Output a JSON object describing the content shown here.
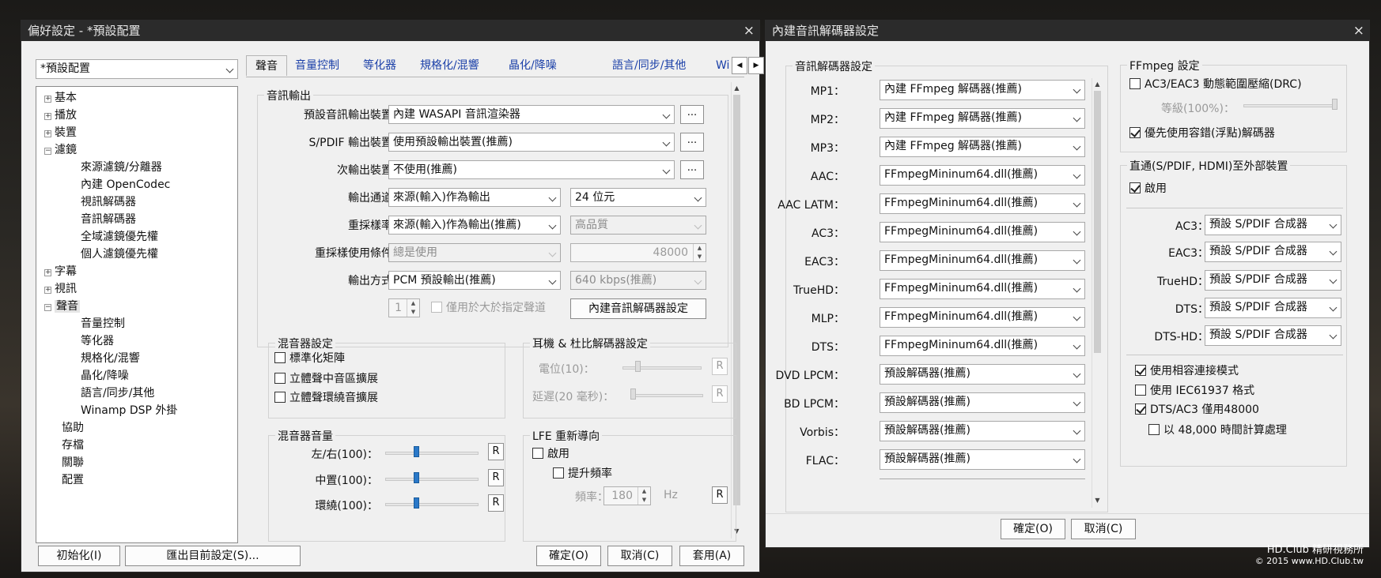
{
  "left_window": {
    "title": "偏好設定 - *預設配置",
    "close_label": "×",
    "profile_select": "*預設配置",
    "tree": [
      {
        "label": "基本",
        "toggle": "+"
      },
      {
        "label": "播放",
        "toggle": "+"
      },
      {
        "label": "裝置",
        "toggle": "+"
      },
      {
        "label": "濾鏡",
        "toggle": "−"
      },
      {
        "label": "來源濾鏡/分離器"
      },
      {
        "label": "內建 OpenCodec"
      },
      {
        "label": "視訊解碼器"
      },
      {
        "label": "音訊解碼器"
      },
      {
        "label": "全域濾鏡優先權"
      },
      {
        "label": "個人濾鏡優先權"
      },
      {
        "label": "字幕",
        "toggle": "+"
      },
      {
        "label": "視訊",
        "toggle": "+"
      },
      {
        "label": "聲音",
        "toggle": "−"
      },
      {
        "label": "音量控制"
      },
      {
        "label": "等化器"
      },
      {
        "label": "規格化/混響"
      },
      {
        "label": "晶化/降噪"
      },
      {
        "label": "語言/同步/其他"
      },
      {
        "label": "Winamp DSP 外掛"
      },
      {
        "label": "協助"
      },
      {
        "label": "存檔"
      },
      {
        "label": "關聯"
      },
      {
        "label": "配置"
      }
    ],
    "tabs": [
      "聲音",
      "音量控制",
      "等化器",
      "規格化/混響",
      "晶化/降噪",
      "語言/同步/其他",
      "Wi"
    ],
    "audio_output": {
      "group_title": "音訊輸出",
      "default_device_label": "預設音訊輸出裝置：",
      "default_device_value": "內建 WASAPI 音訊渲染器",
      "spdif_label": "S/PDIF 輸出裝置：",
      "spdif_value": "使用預設輸出裝置(推薦)",
      "secondary_label": "次輸出裝置：",
      "secondary_value": "不使用(推薦)",
      "channels_label": "輸出通道：",
      "channels_value": "來源(輸入)作為輸出",
      "bits_value": "24 位元",
      "resample_label": "重採樣率：",
      "resample_value": "來源(輸入)作為輸出(推薦)",
      "quality_value": "高品質",
      "resample_cond_label": "重採樣使用條件：",
      "resample_cond_value": "總是使用",
      "sample_rate_value": "48000",
      "output_method_label": "輸出方式：",
      "output_method_value": "PCM 預設輸出(推薦)",
      "bitrate_value": "640 kbps(推薦)",
      "channel_count_value": "1",
      "only_above_label": "僅用於大於指定聲道",
      "builtin_decoder_button": "內建音訊解碼器設定",
      "more_button": "..."
    },
    "mixer": {
      "title": "混音器設定",
      "normalize_matrix": "標準化矩陣",
      "stereo_center": "立體聲中音區擴展",
      "stereo_surround": "立體聲環繞音擴展"
    },
    "headphone": {
      "title": "耳機 & 杜比解碼器設定",
      "level_label": "電位(10)：",
      "delay_label": "延遲(20 毫秒)：",
      "reset_label": "R"
    },
    "mixer_volume": {
      "title": "混音器音量",
      "lr_label": "左/右(100)：",
      "center_label": "中置(100)：",
      "surround_label": "環繞(100)：",
      "reset_label": "R"
    },
    "lfe": {
      "title": "LFE 重新導向",
      "enable": "啟用",
      "boost": "提升頻率",
      "freq_label": "頻率：",
      "freq_value": "180",
      "hz_label": "Hz",
      "reset_label": "R"
    },
    "footer": {
      "init": "初始化(I)",
      "export": "匯出目前設定(S)...",
      "ok": "確定(O)",
      "cancel": "取消(C)",
      "apply": "套用(A)"
    }
  },
  "right_window": {
    "title": "內建音訊解碼器設定",
    "close_label": "×",
    "decoder_group_title": "音訊解碼器設定",
    "decoders": [
      {
        "label": "MP1：",
        "value": "內建 FFmpeg 解碼器(推薦)"
      },
      {
        "label": "MP2：",
        "value": "內建 FFmpeg 解碼器(推薦)"
      },
      {
        "label": "MP3：",
        "value": "內建 FFmpeg 解碼器(推薦)"
      },
      {
        "label": "AAC：",
        "value": "FFmpegMininum64.dll(推薦)"
      },
      {
        "label": "AAC LATM：",
        "value": "FFmpegMininum64.dll(推薦)"
      },
      {
        "label": "AC3：",
        "value": "FFmpegMininum64.dll(推薦)"
      },
      {
        "label": "EAC3：",
        "value": "FFmpegMininum64.dll(推薦)"
      },
      {
        "label": "TrueHD：",
        "value": "FFmpegMininum64.dll(推薦)"
      },
      {
        "label": "MLP：",
        "value": "FFmpegMininum64.dll(推薦)"
      },
      {
        "label": "DTS：",
        "value": "FFmpegMininum64.dll(推薦)"
      },
      {
        "label": "DVD LPCM：",
        "value": "預設解碼器(推薦)"
      },
      {
        "label": "BD LPCM：",
        "value": "預設解碼器(推薦)"
      },
      {
        "label": "Vorbis：",
        "value": "預設解碼器(推薦)"
      },
      {
        "label": "FLAC：",
        "value": "預設解碼器(推薦)"
      }
    ],
    "ffmpeg": {
      "title": "FFmpeg 設定",
      "drc": "AC3/EAC3 動態範圍壓縮(DRC)",
      "level_label": "等級(100%)：",
      "prefer_float": "優先使用容錯(浮點)解碼器"
    },
    "passthrough": {
      "title": "直通(S/PDIF, HDMI)至外部裝置",
      "enable": "啟用",
      "items": [
        {
          "label": "AC3：",
          "value": "預設 S/PDIF 合成器"
        },
        {
          "label": "EAC3：",
          "value": "預設 S/PDIF 合成器"
        },
        {
          "label": "TrueHD：",
          "value": "預設 S/PDIF 合成器"
        },
        {
          "label": "DTS：",
          "value": "預設 S/PDIF 合成器"
        },
        {
          "label": "DTS-HD：",
          "value": "預設 S/PDIF 合成器"
        }
      ],
      "compat_mode": "使用相容連接模式",
      "iec61937": "使用 IEC61937 格式",
      "dts_ac3_48000": "DTS/AC3 僅用48000",
      "calc_48000": "以 48,000 時間計算處理"
    },
    "footer": {
      "ok": "確定(O)",
      "cancel": "取消(C)"
    }
  },
  "watermark": {
    "line1": "HD.Club 精研視務所",
    "line2": "© 2015  www.HD.Club.tw"
  }
}
